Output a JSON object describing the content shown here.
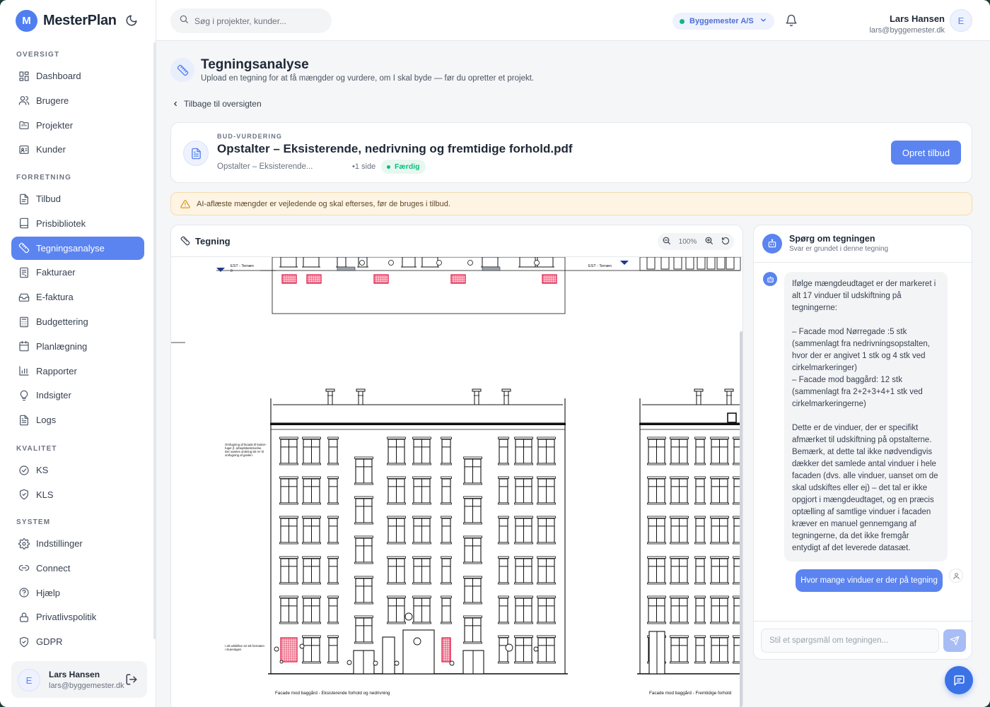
{
  "app": {
    "name": "MesterPlan",
    "logo_letter": "M"
  },
  "sidebar": {
    "sections": [
      {
        "title": "OVERSIGT",
        "items": [
          {
            "label": "Dashboard",
            "icon": "dashboard-icon"
          },
          {
            "label": "Brugere",
            "icon": "users-icon"
          },
          {
            "label": "Projekter",
            "icon": "folder-icon"
          },
          {
            "label": "Kunder",
            "icon": "customer-icon"
          }
        ]
      },
      {
        "title": "FORRETNING",
        "items": [
          {
            "label": "Tilbud",
            "icon": "document-icon"
          },
          {
            "label": "Prisbibliotek",
            "icon": "book-icon"
          },
          {
            "label": "Tegningsanalyse",
            "icon": "ruler-icon",
            "active": true
          },
          {
            "label": "Fakturaer",
            "icon": "invoice-icon"
          },
          {
            "label": "E-faktura",
            "icon": "inbox-icon"
          },
          {
            "label": "Budgettering",
            "icon": "calculator-icon"
          },
          {
            "label": "Planlægning",
            "icon": "calendar-icon"
          },
          {
            "label": "Rapporter",
            "icon": "bar-chart-icon"
          },
          {
            "label": "Indsigter",
            "icon": "lightbulb-icon"
          },
          {
            "label": "Logs",
            "icon": "file-text-icon"
          }
        ]
      },
      {
        "title": "KVALITET",
        "items": [
          {
            "label": "KS",
            "icon": "check-circle-icon"
          },
          {
            "label": "KLS",
            "icon": "shield-check-icon"
          }
        ]
      },
      {
        "title": "SYSTEM",
        "items": [
          {
            "label": "Indstillinger",
            "icon": "gear-icon"
          },
          {
            "label": "Connect",
            "icon": "link-icon"
          },
          {
            "label": "Hjælp",
            "icon": "help-circle-icon"
          },
          {
            "label": "Privatlivspolitik",
            "icon": "lock-icon"
          },
          {
            "label": "GDPR",
            "icon": "shield-icon"
          }
        ]
      }
    ],
    "user": {
      "initial": "E",
      "name": "Lars Hansen",
      "email": "lars@byggemester.dk"
    }
  },
  "header": {
    "search_placeholder": "Søg i projekter, kunder...",
    "company": "Byggemester A/S",
    "user_name": "Lars Hansen",
    "user_email": "lars@byggemester.dk",
    "user_initial": "E"
  },
  "page": {
    "title": "Tegningsanalyse",
    "subtitle": "Upload en tegning for at få mængder og vurdere, om I skal byde — før du opretter et projekt.",
    "back_label": "Tilbage til oversigten"
  },
  "document": {
    "kicker": "BUD-VURDERING",
    "title": "Opstalter – Eksisterende, nedrivning og fremtidige forhold.pdf",
    "short_name": "Opstalter – Eksisterende...",
    "pages": "•1 side",
    "status": "Færdig",
    "action_label": "Opret tilbud"
  },
  "warning": {
    "text": "AI-aflæste mængder er vejledende og skal efterses, før de bruges i tilbud."
  },
  "drawing": {
    "title": "Tegning",
    "zoom": "100%",
    "labels": {
      "terrain_left": "EST - Terræn",
      "terrain_right": "EST - Terræn",
      "terrain_zero": "0",
      "caption_left": "Facade mod baggård - Eksisterende forhold og nedrivning",
      "caption_right": "Facade mod baggård - Fremtidige forhold",
      "note_top": "Omfugning af facade til kanter-fuger jf. arbejdsbeskrivelse. Der samles omkring 50 m² til omfugning af gavlen.",
      "note_bottom": "I alt udskiftes 42 stk formaten i stueetagen"
    }
  },
  "chat": {
    "title": "Spørg om tegningen",
    "subtitle": "Svar er grundet i denne tegning",
    "bot_message": "Ifølge mængdeudtaget er der markeret i alt 17 vinduer til udskiftning på tegningerne:\n\n– Facade mod Nørregade :5 stk (sammenlagt fra nedrivningsopstalten, hvor der er angivet 1 stk og 4 stk ved cirkelmarkeringer)\n– Facade mod baggård: 12 stk (sammenlagt fra 2+2+3+4+1 stk ved cirkelmarkeringerne)\n\nDette er de vinduer, der er specifikt afmærket til udskiftning på opstalterne. Bemærk, at dette tal ikke nødvendigvis dækker det samlede antal vinduer i hele facaden (dvs. alle vinduer, uanset om de skal udskiftes eller ej) – det tal er ikke opgjort i mængdeudtaget, og en præcis optælling af samtlige vinduer i facaden kræver en manuel gennemgang af tegningerne, da det ikke fremgår entydigt af det leverede datasæt.",
    "user_message": "Hvor mange vinduer er der på tegning",
    "input_placeholder": "Stil et spørgsmål om tegningen..."
  },
  "colors": {
    "accent": "#5b84f0",
    "success": "#10b981",
    "warning_bg": "#fdf4e3",
    "window_red": "#e11d48"
  }
}
